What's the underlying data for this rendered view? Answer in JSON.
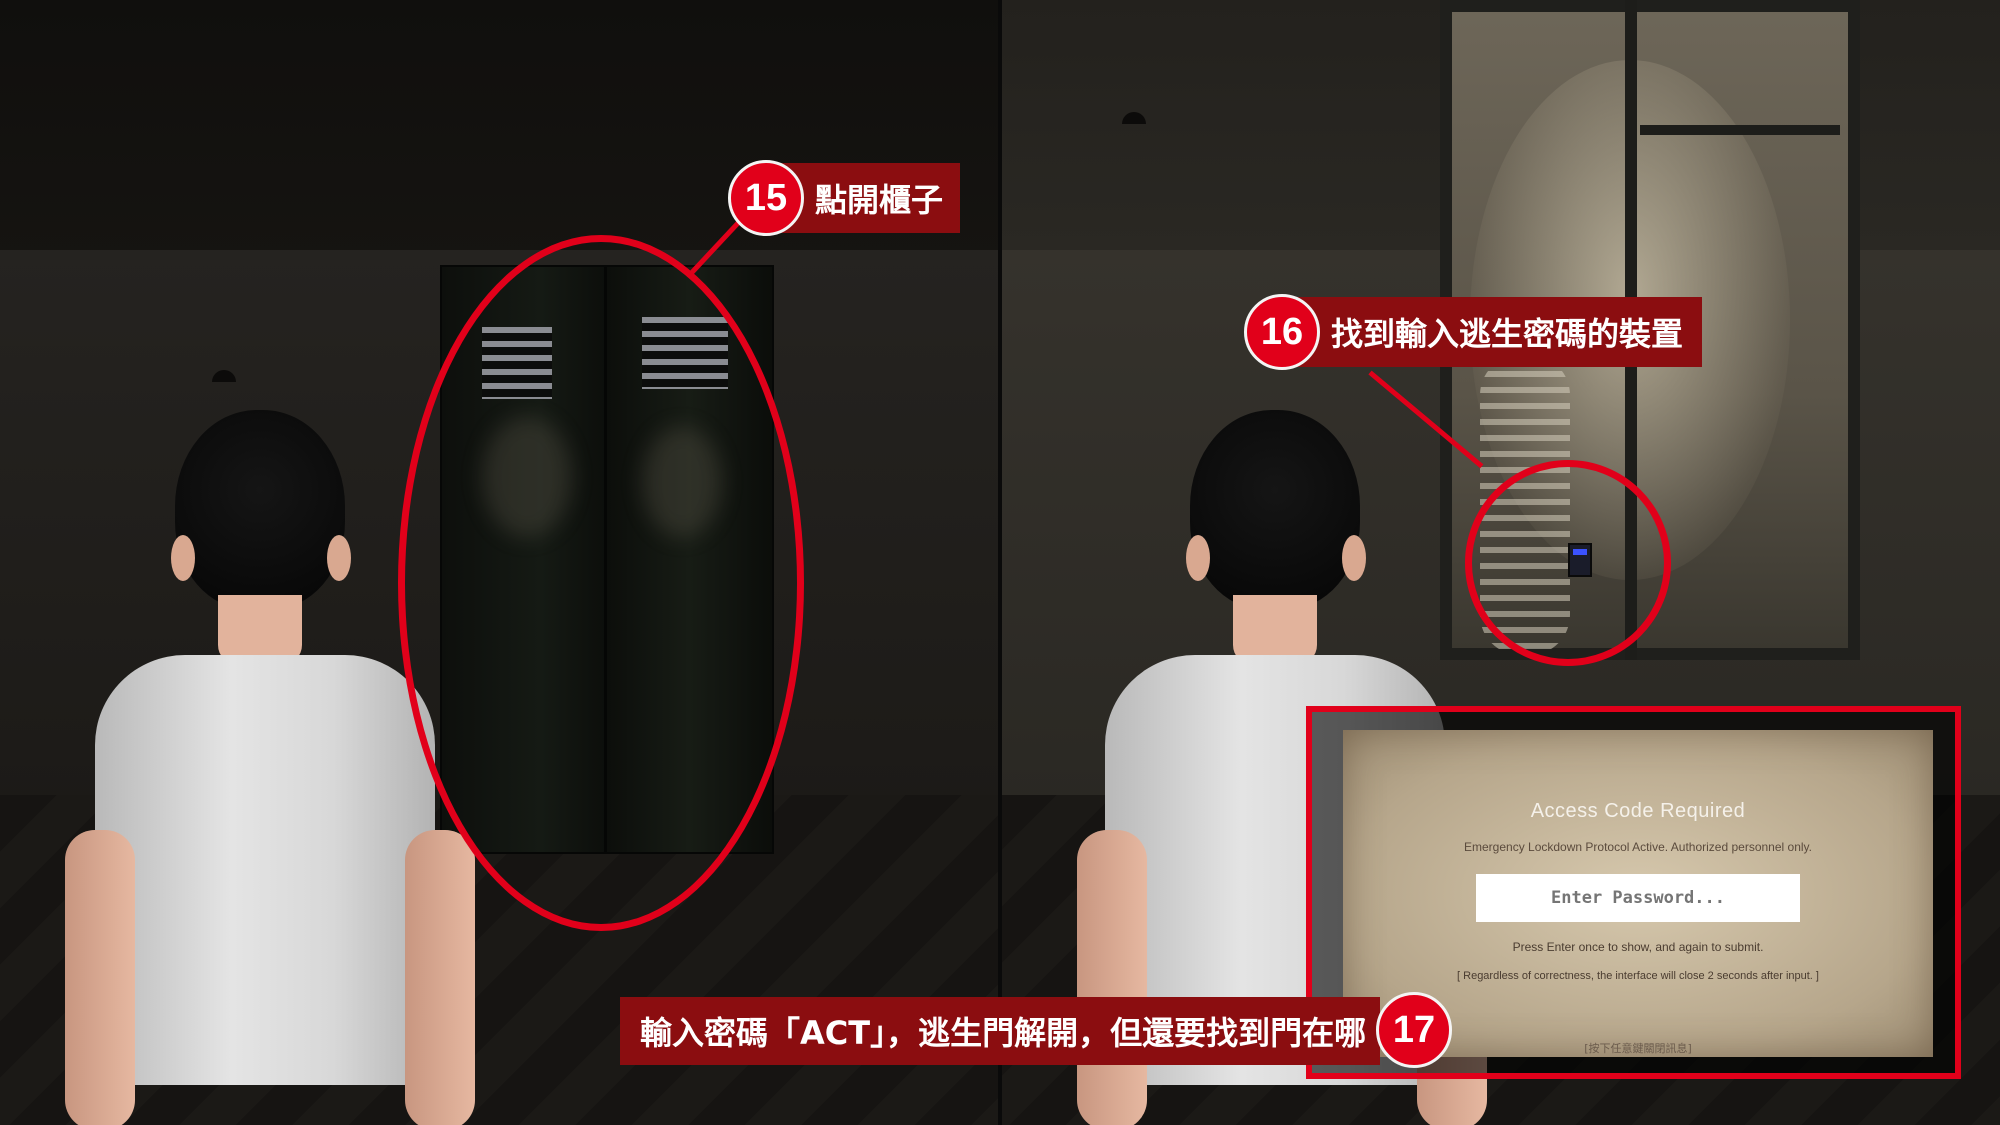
{
  "callouts": {
    "step15": {
      "number": "15",
      "text": "點開櫃子"
    },
    "step16": {
      "number": "16",
      "text": "找到輸入逃生密碼的裝置"
    },
    "step17": {
      "number": "17",
      "text": "輸入密碼「ACT」，逃生門解開，但還要找到門在哪"
    }
  },
  "dialog": {
    "title": "Access Code Required",
    "subtitle": "Emergency Lockdown Protocol Active. Authorized personnel only.",
    "input_placeholder": "Enter Password...",
    "hint": "Press Enter once to show, and again to submit.",
    "note": "[ Regardless of correctness, the interface will close 2 seconds after input. ]",
    "footer": "[按下任意鍵關閉訊息]"
  },
  "colors": {
    "annotation_red": "#e1001a",
    "callout_bg": "#8b0d10",
    "keypad_screen": "#3b52ff"
  }
}
